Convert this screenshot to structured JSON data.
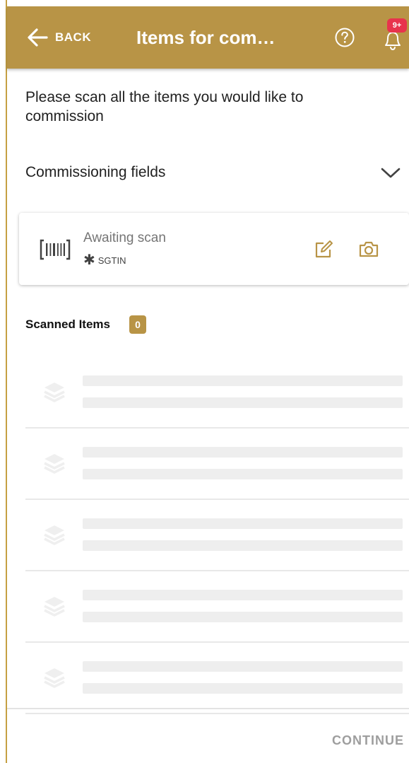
{
  "appbar": {
    "back_label": "BACK",
    "title": "Items for com…",
    "notification_badge": "9+",
    "color": "#b89446"
  },
  "instruction": "Please scan all the items you would like to commission",
  "fields": {
    "label": "Commissioning fields"
  },
  "scan_card": {
    "status": "Awaiting scan",
    "required_mark": "✱",
    "type": "SGTIN",
    "icons": [
      "barcode-icon",
      "edit-icon",
      "camera-icon"
    ]
  },
  "scanned": {
    "label": "Scanned Items",
    "count": "0"
  },
  "footer": {
    "continue_label": "CONTINUE"
  },
  "colors": {
    "accent": "#b89446",
    "badge": "#e8334d",
    "skeleton": "#eeeeee"
  }
}
